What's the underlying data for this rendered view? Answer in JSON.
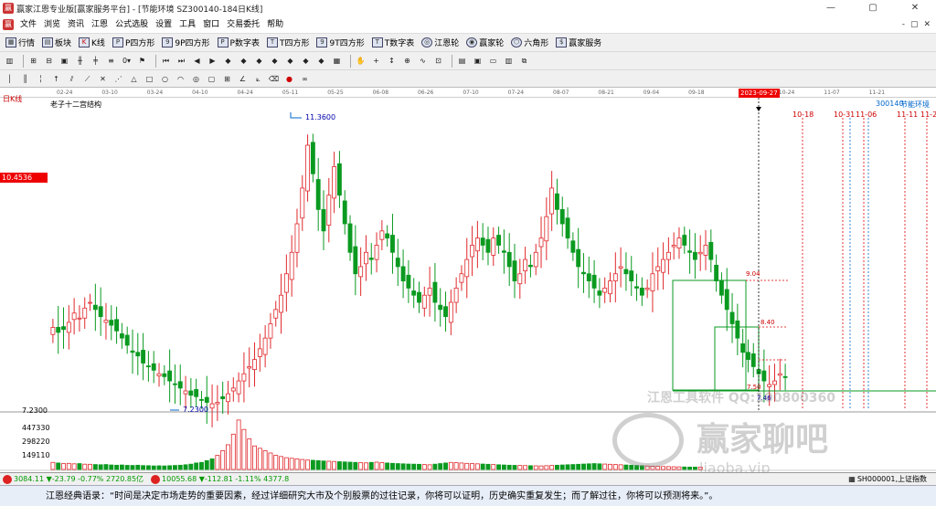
{
  "window": {
    "title": "赢家江恩专业版[赢家服务平台] - [节能环境  SZ300140-184日K线]",
    "controls": [
      "—",
      "▢",
      "✕"
    ]
  },
  "menu": {
    "items": [
      "文件",
      "浏览",
      "资讯",
      "江恩",
      "公式选股",
      "设置",
      "工具",
      "窗口",
      "交易委托",
      "帮助"
    ],
    "right": [
      "-",
      "▢",
      "✕"
    ]
  },
  "toolbar1": {
    "items": [
      "行情",
      "板块",
      "K线",
      "P四方形",
      "9P四方形",
      "P数字表",
      "T四方形",
      "9T四方形",
      "T数字表",
      "江恩轮",
      "赢家轮",
      "六角形",
      "赢家服务"
    ]
  },
  "datebar": {
    "dates": [
      "02-24",
      "03-10",
      "03-24",
      "04-10",
      "04-24",
      "05-11",
      "05-25",
      "06-08",
      "06-26",
      "07-10",
      "07-24",
      "08-07",
      "08-21",
      "09-04",
      "09-18",
      "10-24",
      "11-07",
      "11-21"
    ],
    "selected": "2023-09-27"
  },
  "chart": {
    "period_label": "日K线",
    "indicator_title": "老子十二宫结构",
    "stock_code": "300140",
    "stock_name": "节能环境",
    "high_label": "11.3600",
    "low_label": "7.2300",
    "price_marker": "10.4536",
    "price_bottom": "7.2300",
    "box_labels": [
      "9.04",
      "8.40",
      "7.50",
      "7.46"
    ],
    "future_dates": [
      "10-18",
      "10-31",
      "11-06",
      "11-11",
      "11-2"
    ],
    "volume_ticks": [
      "447330",
      "298220",
      "149110"
    ],
    "colors": {
      "up": "#e0282c",
      "down": "#0a9a20",
      "box": "#0a9a20",
      "marker": "#e00000"
    }
  },
  "chart_data": {
    "type": "candlestick",
    "title": "老子十二宫结构",
    "symbol": "300140",
    "name": "节能环境",
    "high": 11.36,
    "low": 7.23,
    "closes": [
      8.35,
      8.28,
      8.32,
      8.42,
      8.55,
      8.48,
      8.62,
      8.7,
      8.6,
      8.5,
      8.45,
      8.38,
      8.3,
      8.2,
      8.1,
      8.0,
      7.95,
      7.85,
      7.8,
      7.75,
      7.7,
      7.66,
      7.6,
      7.55,
      7.5,
      7.46,
      7.4,
      7.38,
      7.33,
      7.3,
      7.28,
      7.3,
      7.35,
      7.42,
      7.5,
      7.6,
      7.7,
      7.8,
      7.9,
      8.05,
      8.2,
      8.4,
      8.6,
      8.8,
      9.1,
      9.4,
      9.8,
      10.3,
      10.9,
      10.5,
      10.0,
      9.7,
      10.2,
      10.6,
      10.2,
      9.8,
      9.4,
      9.1,
      9.2,
      9.4,
      9.3,
      9.5,
      9.7,
      9.6,
      9.4,
      9.2,
      9.0,
      8.9,
      8.8,
      8.7,
      8.8,
      8.9,
      8.7,
      8.6,
      8.5,
      8.7,
      8.9,
      9.1,
      9.3,
      9.5,
      9.6,
      9.5,
      9.4,
      9.6,
      9.5,
      9.4,
      9.2,
      9.0,
      9.1,
      9.3,
      9.2,
      9.4,
      9.6,
      9.9,
      10.3,
      10.0,
      9.8,
      9.6,
      9.4,
      9.2,
      9.1,
      9.0,
      8.9,
      8.8,
      8.9,
      9.0,
      9.1,
      9.2,
      9.1,
      9.0,
      8.9,
      8.8,
      8.9,
      9.1,
      9.2,
      9.3,
      9.4,
      9.5,
      9.6,
      9.5,
      9.4,
      9.3,
      9.4,
      9.5,
      9.3,
      9.0,
      8.8,
      8.6,
      8.4,
      8.2,
      8.0,
      7.9,
      7.8,
      7.7,
      7.6,
      7.55,
      7.6,
      7.7,
      7.65
    ],
    "volumes_k": [
      60,
      55,
      50,
      52,
      48,
      50,
      45,
      44,
      42,
      40,
      42,
      38,
      36,
      38,
      35,
      34,
      36,
      33,
      32,
      30,
      31,
      30,
      32,
      34,
      36,
      40,
      45,
      55,
      60,
      75,
      90,
      120,
      160,
      210,
      300,
      420,
      340,
      260,
      200,
      180,
      160,
      140,
      120,
      110,
      100,
      95,
      90,
      85,
      80,
      78,
      75,
      72,
      70,
      68,
      66,
      64,
      62,
      60,
      58,
      56,
      60,
      62,
      58,
      55,
      52,
      50,
      48,
      46,
      45,
      44,
      42,
      40,
      45,
      50,
      55,
      60,
      58,
      55,
      52,
      50,
      48,
      46,
      44,
      42,
      40,
      38,
      36,
      35,
      34,
      33,
      32,
      31,
      30,
      32,
      34,
      36,
      38,
      40,
      42,
      44,
      46,
      48,
      50,
      48,
      46,
      44,
      42,
      40,
      38,
      36,
      34,
      32,
      30,
      28,
      26,
      25,
      24,
      23,
      22,
      21,
      20,
      20,
      20
    ]
  },
  "bottom": {
    "index1": "3084.11 ▼-23.79 -0.77% 2720.85亿",
    "index2": "10055.68 ▼-112.81 -1.11% 4377.8",
    "index_right": "SH000001,上证指数"
  },
  "quote": {
    "text": "江恩经典语录：“时间是决定市场走势的重要因素，经过详细研究大市及个别股票的过往记录，你将可以证明，历史确实重复发生；而了解过往，你将可以预测将来。”。"
  },
  "watermark": {
    "software": "江恩工具软件 QQ:100800360",
    "forum": "赢家聊吧",
    "site": "liaoba.vip"
  }
}
